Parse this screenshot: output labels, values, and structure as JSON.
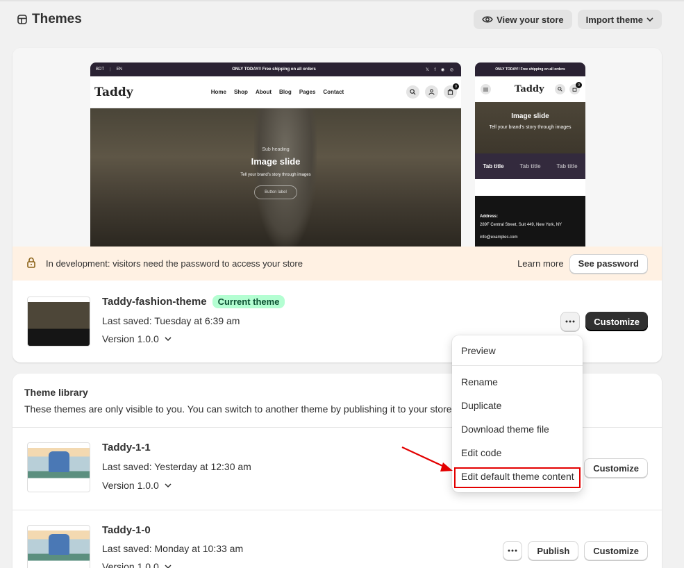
{
  "header": {
    "title": "Themes",
    "view_store": "View your store",
    "import_theme": "Import theme"
  },
  "preview": {
    "desktop": {
      "currency": "BDT",
      "language": "EN",
      "announcement_bold": "ONLY TODAY!!",
      "announcement_rest": " Free shipping on all orders",
      "logo": "Taddy",
      "nav": [
        "Home",
        "Shop",
        "About",
        "Blog",
        "Pages",
        "Contact"
      ],
      "cart_count": "0",
      "hero_sub": "Sub heading",
      "hero_title": "Image slide",
      "hero_desc": "Tell your brand's story through images",
      "hero_button": "Button label"
    },
    "mobile": {
      "announcement": "ONLY TODAY!! Free shipping on all orders",
      "logo": "Taddy",
      "cart_count": "0",
      "hero_title": "Image slide",
      "hero_desc": "Tell your brand's story through images",
      "tabs": [
        "Tab title",
        "Tab title",
        "Tab title"
      ],
      "address_label": "Address:",
      "address": "289F Central Street, Suit 449, New York, NY",
      "email": "info@examples.com"
    }
  },
  "banner": {
    "text": "In development: visitors need the password to access your store",
    "learn_more": "Learn more",
    "see_password": "See password"
  },
  "current_theme": {
    "name": "Taddy-fashion-theme",
    "badge": "Current theme",
    "saved": "Last saved: Tuesday at 6:39 am",
    "version": "Version 1.0.0",
    "customize": "Customize"
  },
  "menu": {
    "items": [
      "Preview",
      "Rename",
      "Duplicate",
      "Download theme file",
      "Edit code",
      "Edit default theme content"
    ]
  },
  "library": {
    "title": "Theme library",
    "description": "These themes are only visible to you. You can switch to another theme by publishing it to your store.",
    "themes": [
      {
        "name": "Taddy-1-1",
        "saved": "Last saved: Yesterday at 12:30 am",
        "version": "Version 1.0.0",
        "customize": "Customize"
      },
      {
        "name": "Taddy-1-0",
        "saved": "Last saved: Monday at 10:33 am",
        "version": "Version 1.0.0",
        "publish": "Publish",
        "customize": "Customize"
      }
    ]
  },
  "colors": {
    "annotation_red": "#e30000",
    "badge_green": "#b4fed2",
    "banner_orange": "#fff1e3",
    "primary_dark": "#303030"
  }
}
